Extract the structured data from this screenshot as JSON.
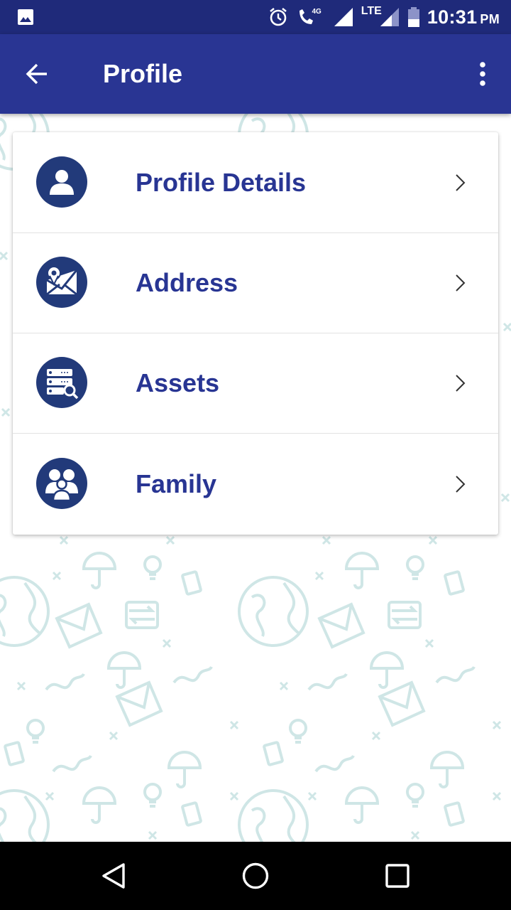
{
  "status_bar": {
    "time": "10:31",
    "ampm": "PM",
    "network_label": "LTE",
    "network_small": "4G",
    "icons": [
      "picture-icon",
      "alarm-icon",
      "wifi-call-icon",
      "signal-icon",
      "signal-icon",
      "battery-icon"
    ]
  },
  "app_bar": {
    "title": "Profile",
    "back_icon": "arrow-left-icon",
    "overflow_icon": "more-vertical-icon"
  },
  "menu": {
    "items": [
      {
        "label": "Profile Details",
        "icon": "user-icon"
      },
      {
        "label": "Address",
        "icon": "map-pin-icon"
      },
      {
        "label": "Assets",
        "icon": "server-search-icon"
      },
      {
        "label": "Family",
        "icon": "family-icon"
      }
    ],
    "chevron_icon": "chevron-right-icon"
  },
  "nav_bar": {
    "icons": [
      "back-triangle-icon",
      "home-circle-icon",
      "recents-square-icon"
    ]
  },
  "colors": {
    "status_bar": "#1f2a7a",
    "app_bar": "#293593",
    "label": "#283593",
    "icon_circle": "#223a7a",
    "pattern": "#cfe6e6"
  }
}
